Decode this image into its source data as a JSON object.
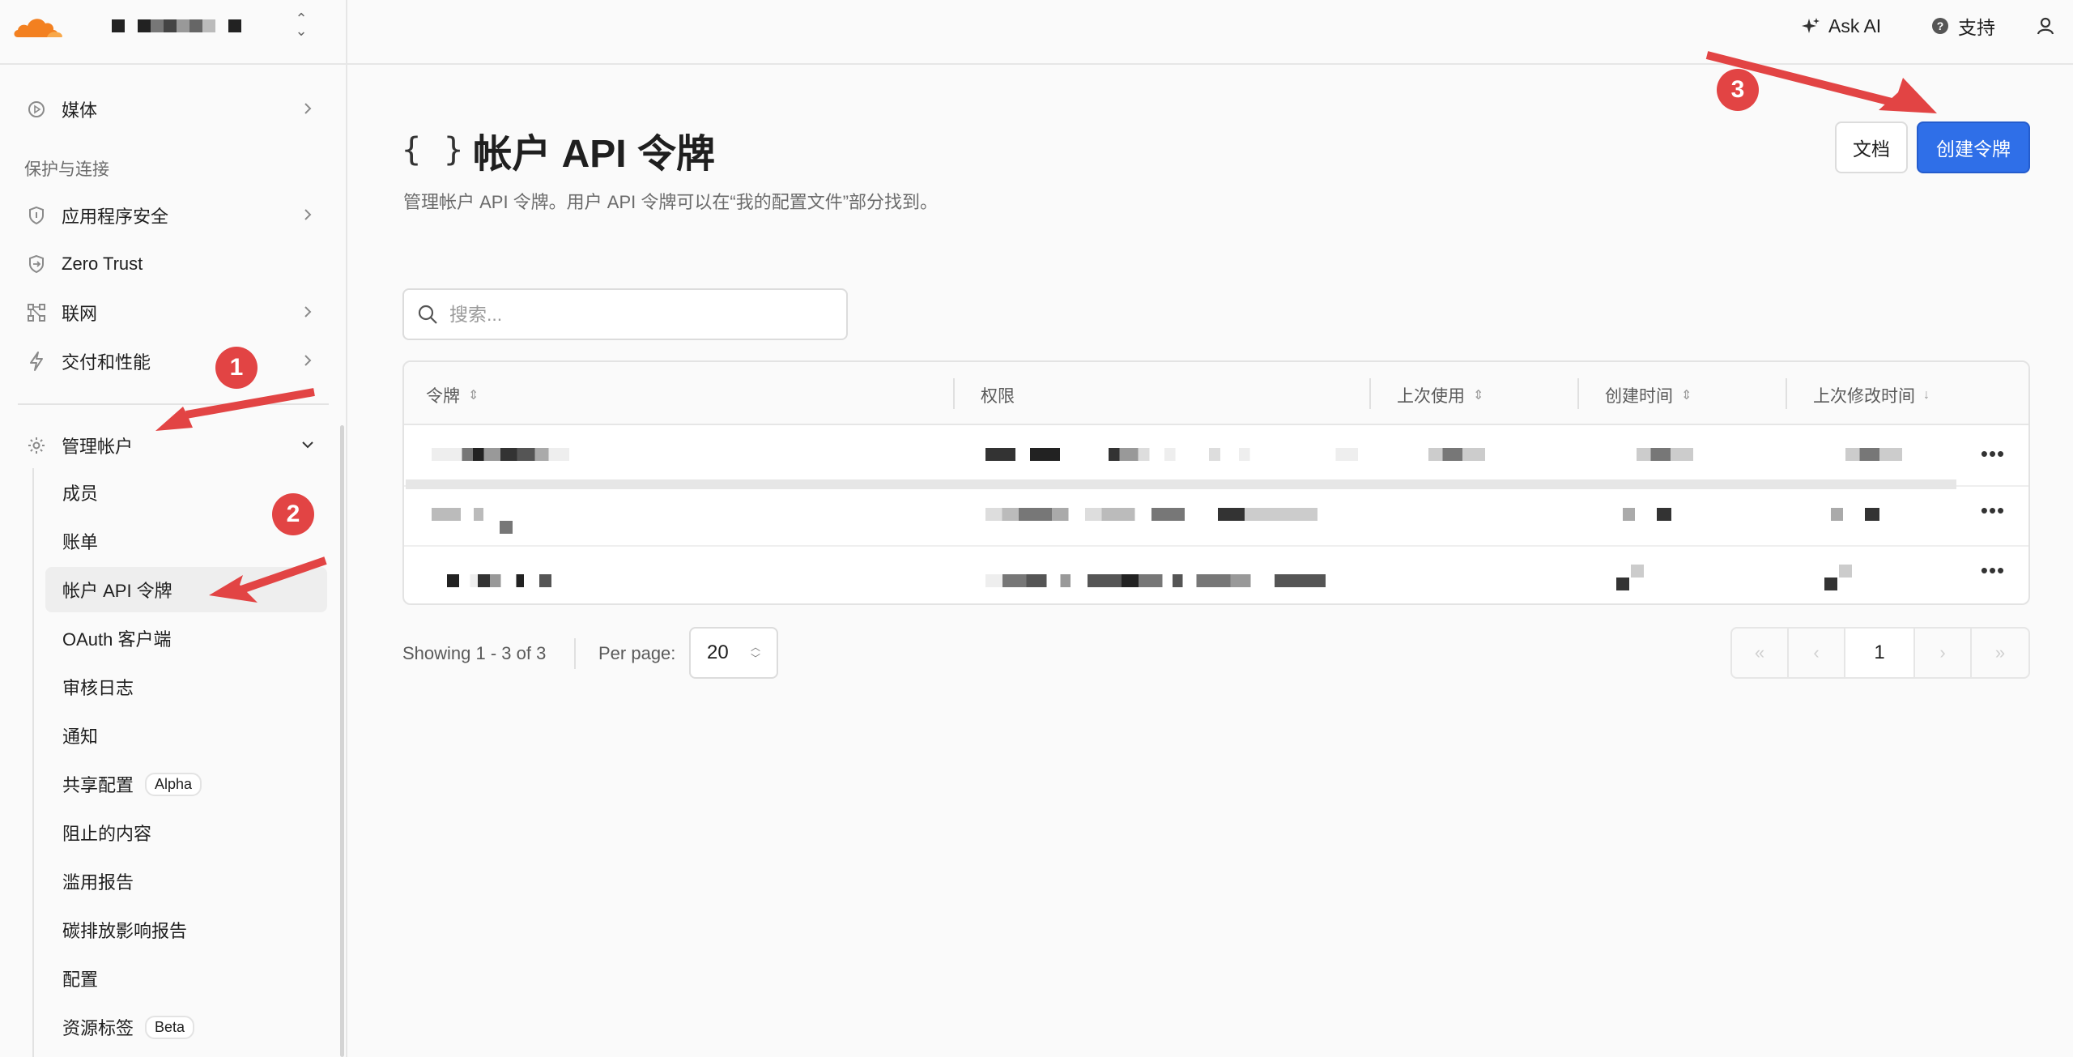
{
  "topbar": {
    "ask_ai": "Ask AI",
    "support": "支持"
  },
  "sidebar": {
    "items": [
      {
        "label": "媒体",
        "icon": "play-circle-icon"
      },
      {
        "section": "保护与连接"
      },
      {
        "label": "应用程序安全",
        "icon": "shield-icon"
      },
      {
        "label": "Zero Trust",
        "icon": "zero-trust-icon"
      },
      {
        "label": "联网",
        "icon": "network-icon"
      },
      {
        "label": "交付和性能",
        "icon": "bolt-icon"
      },
      {
        "label": "管理帐户",
        "icon": "gear-icon"
      }
    ],
    "sub_items": [
      {
        "label": "成员"
      },
      {
        "label": "账单"
      },
      {
        "label": "帐户 API 令牌"
      },
      {
        "label": "OAuth 客户端"
      },
      {
        "label": "审核日志"
      },
      {
        "label": "通知"
      },
      {
        "label": "共享配置",
        "badge": "Alpha"
      },
      {
        "label": "阻止的内容"
      },
      {
        "label": "滥用报告"
      },
      {
        "label": "碳排放影响报告"
      },
      {
        "label": "配置"
      },
      {
        "label": "资源标签",
        "badge": "Beta"
      }
    ]
  },
  "main": {
    "title_braces": "{ }",
    "title": "帐户 API 令牌",
    "description": "管理帐户 API 令牌。用户 API 令牌可以在“我的配置文件”部分找到。",
    "docs_button": "文档",
    "create_button": "创建令牌",
    "search_placeholder": "搜索...",
    "table": {
      "columns": [
        "令牌",
        "权限",
        "上次使用",
        "创建时间",
        "上次修改时间"
      ]
    },
    "footer": {
      "showing": "Showing 1 - 3 of 3",
      "per_page_label": "Per page:",
      "per_page_value": "20",
      "current_page": "1"
    }
  },
  "annotations": [
    "1",
    "2",
    "3"
  ],
  "colors": {
    "accent": "#2f6fe8",
    "annotation": "#e24444",
    "logo_orange": "#f38020"
  }
}
